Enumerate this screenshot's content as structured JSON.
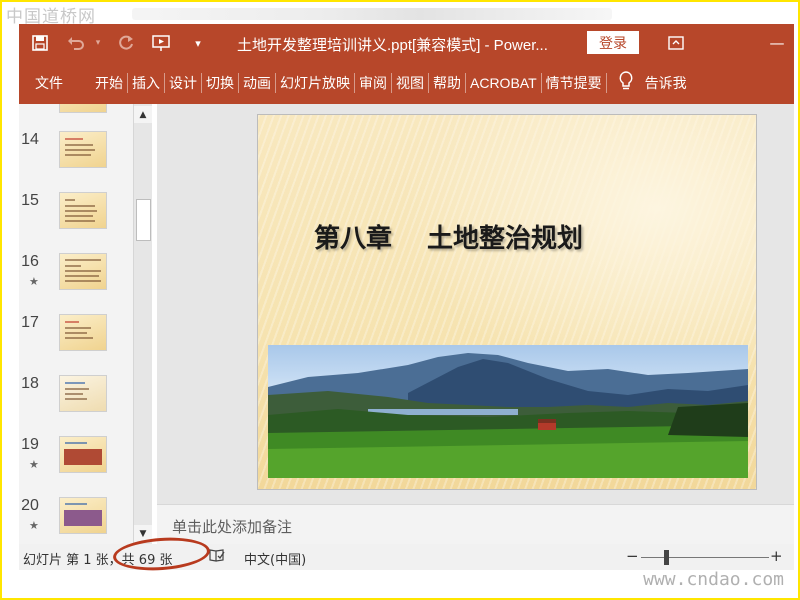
{
  "watermark": {
    "top": "中国道桥网",
    "bottom": "www.cndao.com"
  },
  "titlebar": {
    "doc_title": "土地开发整理培训讲义.ppt[兼容模式]  -  Power...",
    "login": "登录",
    "icons": [
      "save-icon",
      "undo-icon",
      "redo-icon",
      "slideshow-from-start-icon",
      "customize-qat-icon",
      "ribbon-display-options-icon",
      "minimize-icon"
    ]
  },
  "ribbon": {
    "tabs": [
      "文件",
      "开始",
      "插入",
      "设计",
      "切换",
      "动画",
      "幻灯片放映",
      "审阅",
      "视图",
      "帮助",
      "ACROBAT",
      "情节提要"
    ],
    "tell_me": "告诉我"
  },
  "thumbnails": [
    {
      "num": "14",
      "star": ""
    },
    {
      "num": "15",
      "star": ""
    },
    {
      "num": "16",
      "star": "★"
    },
    {
      "num": "17",
      "star": ""
    },
    {
      "num": "18",
      "star": ""
    },
    {
      "num": "19",
      "star": "★"
    },
    {
      "num": "20",
      "star": "★"
    }
  ],
  "slide": {
    "title": "第八章 土地整治规划"
  },
  "notes": {
    "placeholder": "单击此处添加备注"
  },
  "statusbar": {
    "slide_info": "幻灯片 第 1 张，共 69 张",
    "language": "中文(中国)",
    "zoom_minus": "−",
    "zoom_plus": "+"
  },
  "colors": {
    "accent": "#b7472a",
    "annotation": "#b83a1e",
    "watermark_border": "#ffe600"
  }
}
